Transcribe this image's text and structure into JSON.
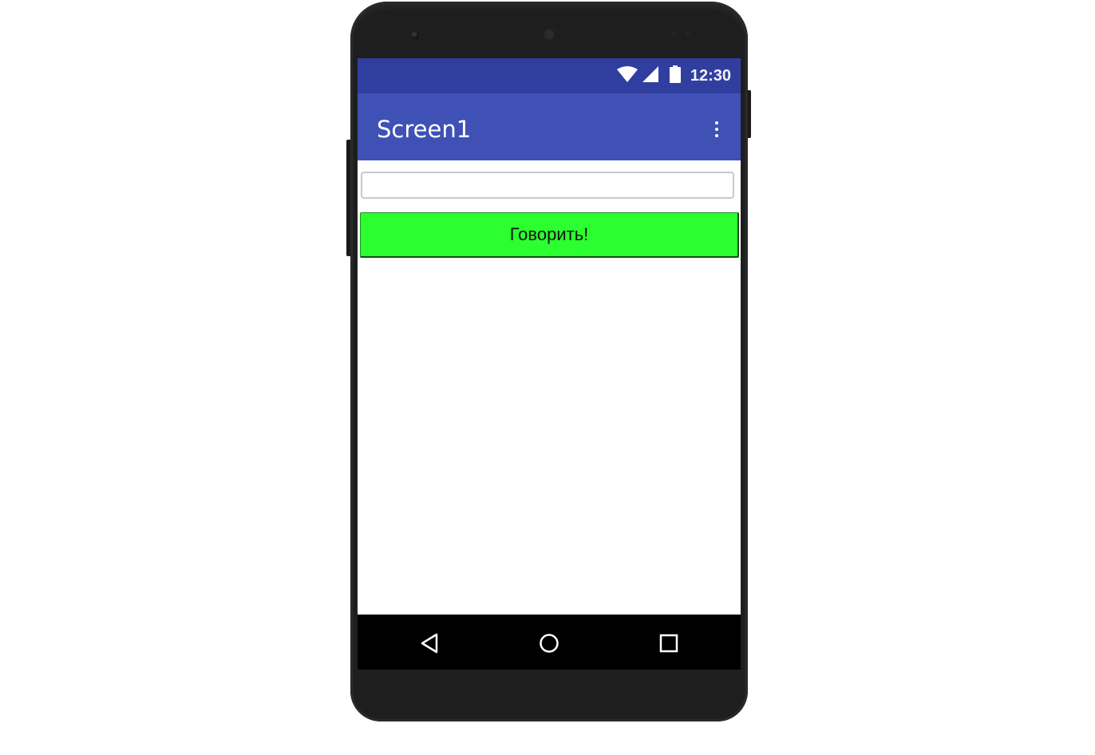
{
  "status_bar": {
    "time": "12:30",
    "icons": [
      "wifi-icon",
      "signal-icon",
      "battery-icon"
    ],
    "color": "#303f9f"
  },
  "app_bar": {
    "title": "Screen1",
    "menu_icon": "overflow-menu-icon",
    "color": "#3f51b5"
  },
  "form": {
    "text_input": {
      "value": "",
      "placeholder": ""
    },
    "speak_button": {
      "label": "Говорить!",
      "color": "#2cff30"
    }
  },
  "nav_bar": {
    "icons": [
      "back-icon",
      "home-icon",
      "recent-apps-icon"
    ]
  }
}
